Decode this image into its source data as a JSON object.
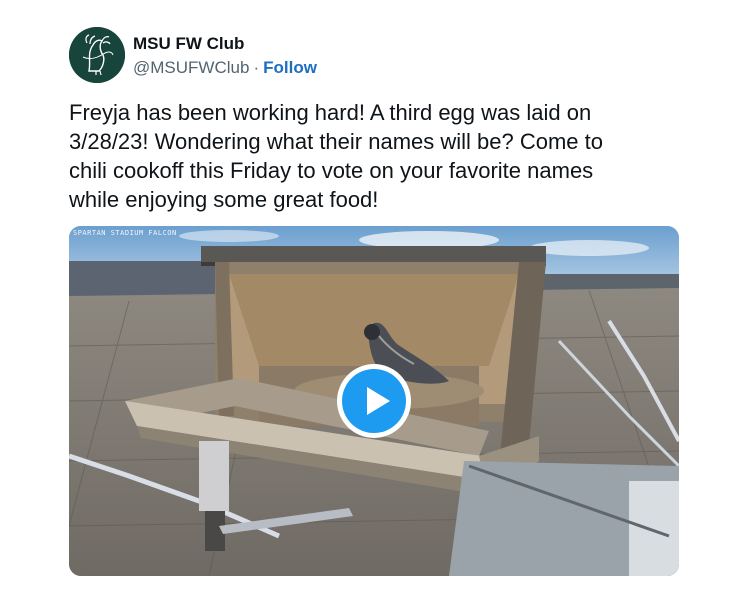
{
  "account": {
    "display_name": "MSU FW Club",
    "handle": "@MSUFWClub",
    "separator": "·",
    "follow_label": "Follow",
    "avatar_icon": "club-logo-icon"
  },
  "tweet": {
    "text": "Freyja has been working hard! A third egg was laid on\n3/28/23! Wondering what their names will be? Come to\nchili cookoff this Friday to vote on your favorite names\nwhile enjoying some great food!"
  },
  "media": {
    "type": "video",
    "watermark": "SPARTAN STADIUM FALCON",
    "play_icon": "play-icon",
    "colors": {
      "play_button": "#1d9bf0",
      "link": "#1d6fc1"
    }
  }
}
